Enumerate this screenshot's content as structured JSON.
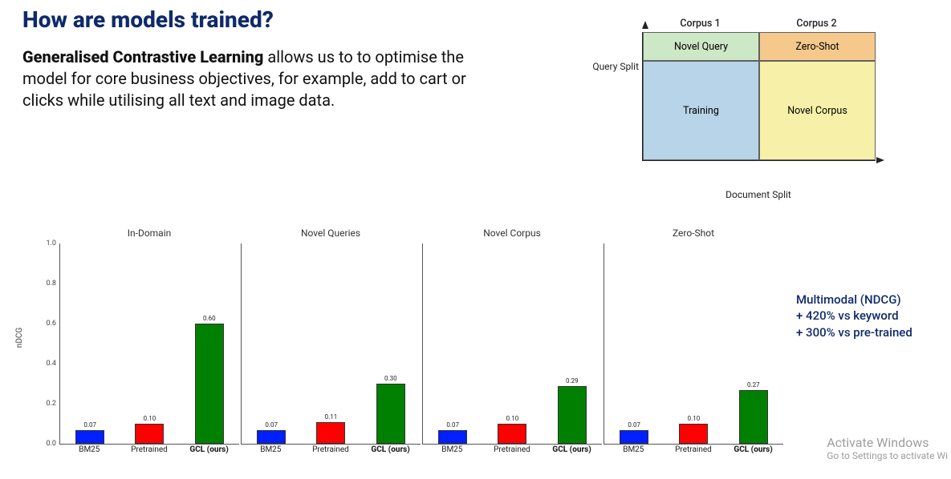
{
  "heading": "How are models trained?",
  "subtitle_bold": "Generalised Contrastive Learning ",
  "subtitle_rest": "allows us to to optimise the model for core business objectives, for example, add to cart or clicks while utilising all text and image data.",
  "quad": {
    "xlabel": "Document Split",
    "ylabel": "Query Split",
    "col1": "Corpus 1",
    "col2": "Corpus 2",
    "novel_query": "Novel Query",
    "zero_shot": "Zero-Shot",
    "training": "Training",
    "novel_corpus": "Novel Corpus",
    "colors": {
      "novel_query": "#cde8c6",
      "zero_shot": "#f5c98c",
      "training": "#b8d4e8",
      "novel_corpus": "#f7f0a8"
    }
  },
  "annotation": {
    "line1": "Multimodal (NDCG)",
    "line2": "+ 420% vs keyword",
    "line3": "+ 300% vs pre-trained"
  },
  "watermark": {
    "title": "Activate Windows",
    "sub": "Go to Settings to activate Wi"
  },
  "chart_data": {
    "type": "bar",
    "ylabel": "nDCG",
    "ylim": [
      0.0,
      1.0
    ],
    "yticks": [
      0.0,
      0.2,
      0.4,
      0.6,
      0.8,
      1.0
    ],
    "categories": [
      "BM25",
      "Pretrained",
      "GCL (ours)"
    ],
    "bar_colors": [
      "#0020ff",
      "#ff0000",
      "#008000"
    ],
    "panels": [
      {
        "title": "In-Domain",
        "values": [
          0.07,
          0.1,
          0.6
        ]
      },
      {
        "title": "Novel Queries",
        "values": [
          0.07,
          0.11,
          0.3
        ]
      },
      {
        "title": "Novel Corpus",
        "values": [
          0.07,
          0.1,
          0.29
        ]
      },
      {
        "title": "Zero-Shot",
        "values": [
          0.07,
          0.1,
          0.27
        ]
      }
    ]
  }
}
